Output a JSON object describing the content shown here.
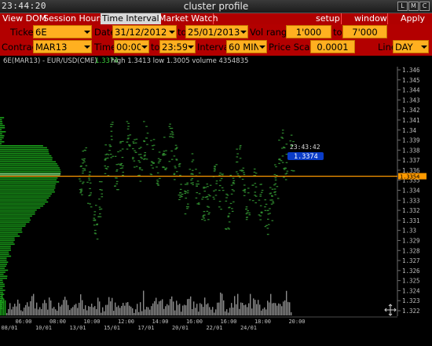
{
  "window": {
    "clock": "23:44:20",
    "title": "cluster profile",
    "buttons": [
      "L",
      "M",
      "C"
    ]
  },
  "menu": {
    "view_dom": "View DOM",
    "session_hours": "Session Hours",
    "time_interval": "Time Interval",
    "market_watch": "Market Watch",
    "setup": "setup",
    "window": "window",
    "apply": "Apply"
  },
  "toolbar": {
    "ticker_label": "Ticker",
    "ticker_value": "6E",
    "date_label": "Date",
    "date_from": "31/12/2012",
    "to_label": "to",
    "date_to": "25/01/2013",
    "vol_range_label": "Vol range",
    "vol_from": "1'000",
    "vol_to_label": "to",
    "vol_to": "7'000",
    "contract_label": "Contract",
    "contract_value": "MAR13",
    "time_label": "Time",
    "time_from": "00:00",
    "time_to_label": "to",
    "time_to": "23:59",
    "interval_label": "Interval",
    "interval_value": "60 MIN",
    "price_scale_label": "Price Scale",
    "price_scale_value": "0.0001",
    "line_label": "Line",
    "line_value": "DAY"
  },
  "info": {
    "symbol": "6E(MAR13) - EUR/USD(CME)",
    "last": "1.3374",
    "hlv": "high 1.3413  low 1.3005  volume 4354835"
  },
  "chart_data": {
    "type": "line",
    "price_axis_labels": [
      "1.346",
      "1.345",
      "1.344",
      "1.343",
      "1.342",
      "1.341",
      "1.34",
      "1.339",
      "1.338",
      "1.337",
      "1.336",
      "1.335",
      "1.334",
      "1.333",
      "1.332",
      "1.331",
      "1.33",
      "1.329",
      "1.328",
      "1.327",
      "1.326",
      "1.325",
      "1.324",
      "1.323",
      "1.322"
    ],
    "time_axis_labels": [
      {
        "time": "06:00",
        "date": "08/01"
      },
      {
        "time": "08:00",
        "date": "10/01"
      },
      {
        "time": "10:00",
        "date": "13/01"
      },
      {
        "time": "12:00",
        "date": "15/01"
      },
      {
        "time": "14:00",
        "date": "17/01"
      },
      {
        "time": "16:00",
        "date": "20/01"
      },
      {
        "time": "16:00",
        "date": "22/01"
      },
      {
        "time": "18:00",
        "date": "24/01"
      },
      {
        "time": "20:00",
        "date": ""
      }
    ],
    "current_price": 1.3374,
    "current_time": "23:43:42",
    "horizontal_line_price": 1.3354,
    "horizontal_line_label": "1.3354",
    "ylim": [
      1.3215,
      1.3465
    ],
    "colors": {
      "profile": "#1aa01a",
      "profile_poc": "#8cff8c",
      "cluster": "#2f8a2f",
      "volume": "#8a8a8a",
      "line": "#ff9a00",
      "price_tag": "#0a3cc8"
    }
  }
}
